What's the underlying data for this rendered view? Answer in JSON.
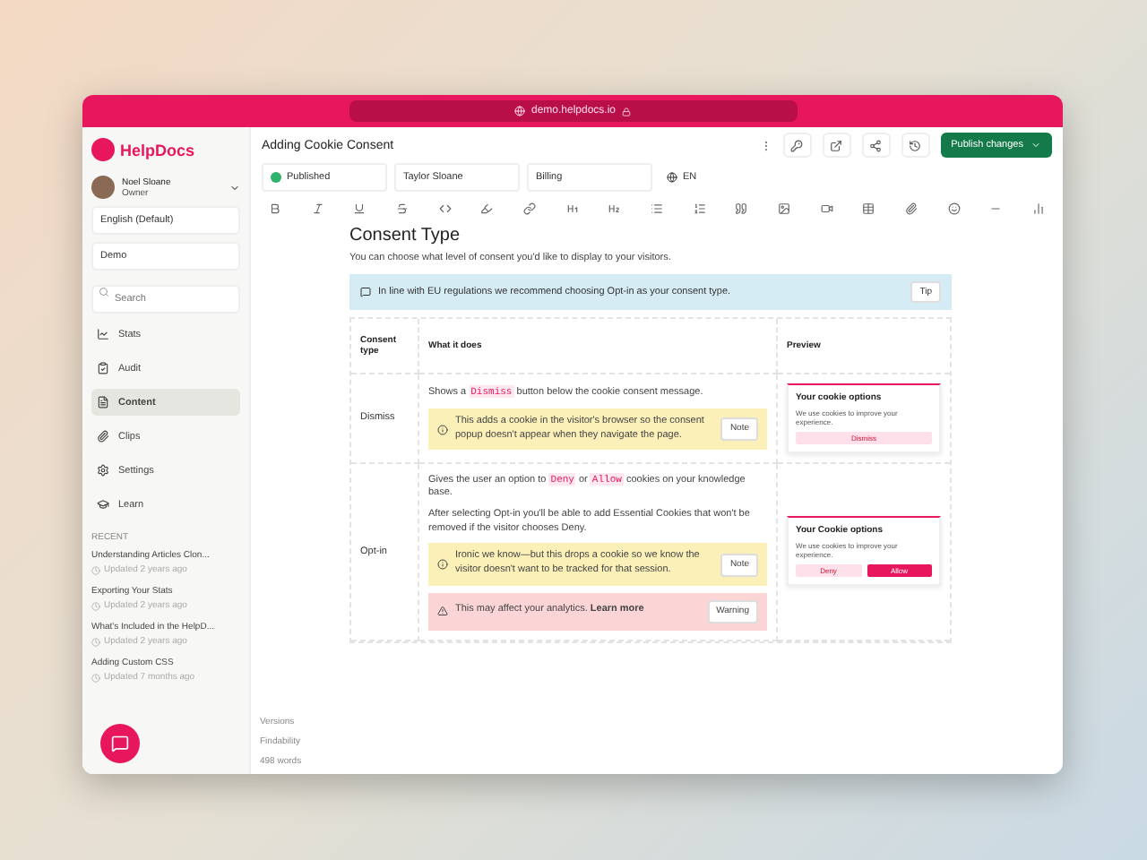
{
  "browser": {
    "url": "demo.helpdocs.io"
  },
  "sidebar": {
    "brand": "HelpDocs",
    "user": {
      "name": "Noel Sloane",
      "role": "Owner"
    },
    "language": "English (Default)",
    "workspace": "Demo",
    "search": {
      "placeholder": "Search"
    },
    "nav": [
      {
        "label": "Stats",
        "selected": false
      },
      {
        "label": "Audit",
        "selected": false
      },
      {
        "label": "Content",
        "selected": true
      },
      {
        "label": "Clips",
        "selected": false
      },
      {
        "label": "Settings",
        "selected": false
      },
      {
        "label": "Learn",
        "selected": false
      }
    ],
    "recent_heading": "RECENT",
    "recent": [
      {
        "title": "Understanding Articles Clon...",
        "updated": "Updated 2 years ago"
      },
      {
        "title": "Exporting Your Stats",
        "updated": "Updated 2 years ago"
      },
      {
        "title": "What's Included in the HelpD...",
        "updated": "Updated 2 years ago"
      },
      {
        "title": "Adding Custom CSS",
        "updated": "Updated 7 months ago"
      }
    ]
  },
  "article": {
    "title": "Adding Cookie Consent",
    "status": "Published",
    "author": "Taylor Sloane",
    "category": "Billing",
    "language": "EN",
    "publish_button": "Publish changes"
  },
  "gutter": [
    "Versions",
    "Findability",
    "498 words"
  ],
  "content": {
    "heading": "Consent Type",
    "intro": "You can choose what level of consent you'd like to display to your visitors.",
    "tip": {
      "text": "In line with EU regulations we recommend choosing Opt-in as your consent type.",
      "badge": "Tip"
    },
    "columns": [
      "Consent type",
      "What it does",
      "Preview"
    ],
    "rows": [
      {
        "type": "Dismiss",
        "paragraphs": [
          [
            {
              "kind": "text",
              "text": "Shows a "
            },
            {
              "kind": "code",
              "text": "Dismiss"
            },
            {
              "kind": "text",
              "text": " button below the cookie consent message."
            }
          ]
        ],
        "callouts": [
          {
            "kind": "note",
            "text": "This adds a cookie in the visitor's browser so the consent popup doesn't appear when they navigate the page.",
            "badge": "Note"
          }
        ],
        "preview": {
          "title": "Your cookie options",
          "body": "We use cookies to improve your experience.",
          "buttons": [
            {
              "label": "Dismiss",
              "kind": "soft"
            }
          ]
        }
      },
      {
        "type": "Opt-in",
        "paragraphs": [
          [
            {
              "kind": "text",
              "text": "Gives the user an option to "
            },
            {
              "kind": "code",
              "text": "Deny"
            },
            {
              "kind": "text",
              "text": " or "
            },
            {
              "kind": "code",
              "text": "Allow"
            },
            {
              "kind": "text",
              "text": " cookies on your knowledge base."
            }
          ],
          [
            {
              "kind": "text",
              "text": "After selecting Opt-in you'll be able to add Essential Cookies that won't be removed if the visitor chooses Deny."
            }
          ]
        ],
        "callouts": [
          {
            "kind": "note",
            "text": "Ironic we know—but this drops a cookie so we know the visitor doesn't want to be tracked for that session.",
            "badge": "Note"
          },
          {
            "kind": "warning",
            "text": "This may affect your analytics. **Learn more**",
            "badge": "Warning"
          }
        ],
        "preview": {
          "title": "Your Cookie options",
          "body": "We use cookies to improve your experience.",
          "buttons": [
            {
              "label": "Deny",
              "kind": "soft"
            },
            {
              "label": "Allow",
              "kind": "solid"
            }
          ]
        }
      }
    ]
  }
}
